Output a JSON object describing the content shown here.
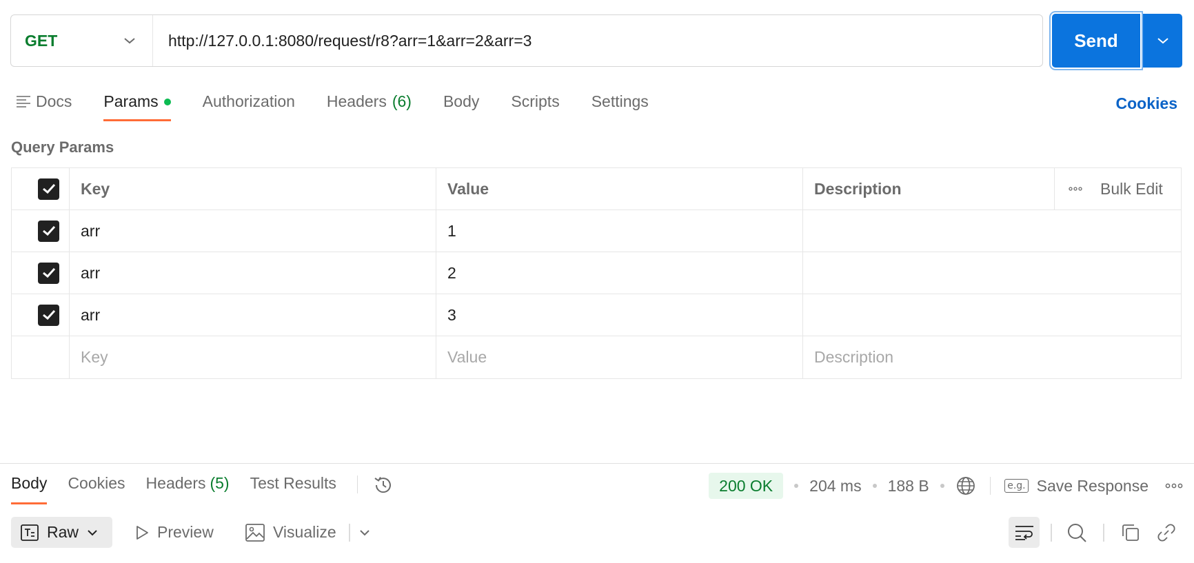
{
  "request": {
    "method": "GET",
    "url": "http://127.0.0.1:8080/request/r8?arr=1&arr=2&arr=3",
    "send_label": "Send"
  },
  "tabs": {
    "docs": "Docs",
    "params": "Params",
    "authorization": "Authorization",
    "headers": "Headers",
    "headers_count": "(6)",
    "body": "Body",
    "scripts": "Scripts",
    "settings": "Settings",
    "cookies": "Cookies"
  },
  "query_params": {
    "title": "Query Params",
    "columns": {
      "key": "Key",
      "value": "Value",
      "description": "Description",
      "bulk_edit": "Bulk Edit"
    },
    "rows": [
      {
        "checked": true,
        "key": "arr",
        "value": "1",
        "description": ""
      },
      {
        "checked": true,
        "key": "arr",
        "value": "2",
        "description": ""
      },
      {
        "checked": true,
        "key": "arr",
        "value": "3",
        "description": ""
      }
    ],
    "placeholder": {
      "key": "Key",
      "value": "Value",
      "description": "Description"
    }
  },
  "response": {
    "tabs": {
      "body": "Body",
      "cookies": "Cookies",
      "headers": "Headers",
      "headers_count": "(5)",
      "test_results": "Test Results"
    },
    "status": "200 OK",
    "time": "204 ms",
    "size": "188 B",
    "save_response": "Save Response",
    "eg_label": "e.g.",
    "format": "Raw",
    "preview": "Preview",
    "visualize": "Visualize"
  },
  "colors": {
    "accent": "#0b74de",
    "method_green": "#0a7d2e",
    "tab_underline": "#ff6c37",
    "status_bg": "#e7f7ec"
  }
}
